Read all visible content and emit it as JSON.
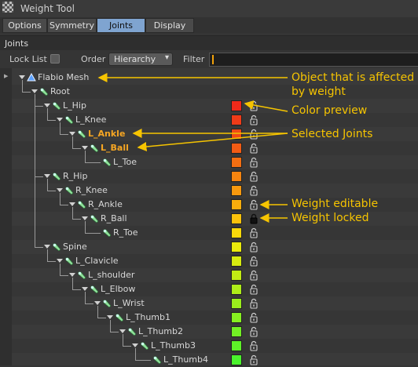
{
  "window": {
    "title": "Weight Tool"
  },
  "tabs": [
    "Options",
    "Symmetry",
    "Joints",
    "Display"
  ],
  "active_tab": 2,
  "section": {
    "label": "Joints"
  },
  "toolbar": {
    "lock_list_label": "Lock List",
    "lock_list_checked": false,
    "order_label": "Order",
    "order_value": "Hierarchy",
    "filter_label": "Filter",
    "filter_value": ""
  },
  "tree": [
    {
      "label": "Flabio Mesh",
      "depth": 0,
      "type": "mesh",
      "has_children": true
    },
    {
      "label": "Root",
      "depth": 1,
      "type": "joint",
      "has_children": true
    },
    {
      "label": "L_Hip",
      "depth": 2,
      "type": "joint",
      "has_children": true,
      "color": "#ee2a1a",
      "locked": false
    },
    {
      "label": "L_Knee",
      "depth": 3,
      "type": "joint",
      "has_children": true,
      "color": "#ef3b18",
      "locked": false
    },
    {
      "label": "L_Ankle",
      "depth": 4,
      "type": "joint",
      "has_children": true,
      "color": "#f04a16",
      "locked": false,
      "selected": true
    },
    {
      "label": "L_Ball",
      "depth": 5,
      "type": "joint",
      "has_children": true,
      "color": "#f25b14",
      "locked": false,
      "selected": true
    },
    {
      "label": "L_Toe",
      "depth": 6,
      "type": "joint",
      "has_children": false,
      "color": "#f36e12",
      "locked": false
    },
    {
      "label": "R_Hip",
      "depth": 2,
      "type": "joint",
      "has_children": true,
      "color": "#f58410",
      "locked": false
    },
    {
      "label": "R_Knee",
      "depth": 3,
      "type": "joint",
      "has_children": true,
      "color": "#f7990e",
      "locked": false
    },
    {
      "label": "R_Ankle",
      "depth": 4,
      "type": "joint",
      "has_children": true,
      "color": "#f9ad0c",
      "locked": false
    },
    {
      "label": "R_Ball",
      "depth": 5,
      "type": "joint",
      "has_children": true,
      "color": "#fbc20b",
      "locked": true
    },
    {
      "label": "R_Toe",
      "depth": 6,
      "type": "joint",
      "has_children": false,
      "color": "#f8d80a",
      "locked": false
    },
    {
      "label": "Spine",
      "depth": 2,
      "type": "joint",
      "has_children": true,
      "color": "#eaea0c",
      "locked": false
    },
    {
      "label": "L_Clavicle",
      "depth": 3,
      "type": "joint",
      "has_children": true,
      "color": "#d6eb10",
      "locked": false
    },
    {
      "label": "L_shoulder",
      "depth": 4,
      "type": "joint",
      "has_children": true,
      "color": "#c2ec14",
      "locked": false
    },
    {
      "label": "L_Elbow",
      "depth": 5,
      "type": "joint",
      "has_children": true,
      "color": "#aeed18",
      "locked": false
    },
    {
      "label": "L_Wrist",
      "depth": 6,
      "type": "joint",
      "has_children": true,
      "color": "#9aee1c",
      "locked": false
    },
    {
      "label": "L_Thumb1",
      "depth": 7,
      "type": "joint",
      "has_children": true,
      "color": "#86ef20",
      "locked": false
    },
    {
      "label": "L_Thumb2",
      "depth": 8,
      "type": "joint",
      "has_children": true,
      "color": "#72f024",
      "locked": false
    },
    {
      "label": "L_Thumb3",
      "depth": 9,
      "type": "joint",
      "has_children": true,
      "color": "#5ef128",
      "locked": false
    },
    {
      "label": "L_Thumb4",
      "depth": 10,
      "type": "joint",
      "has_children": false,
      "color": "#4af22c",
      "locked": false
    }
  ],
  "annotations": [
    {
      "text": "Object that is affected\nby weight"
    },
    {
      "text": "Color preview"
    },
    {
      "text": "Selected Joints"
    },
    {
      "text": "Weight editable"
    },
    {
      "text": "Weight locked"
    }
  ],
  "colors": {
    "accent": "#f6c400",
    "selected_text": "#f6a623",
    "active_tab": "#7fa4d0"
  }
}
